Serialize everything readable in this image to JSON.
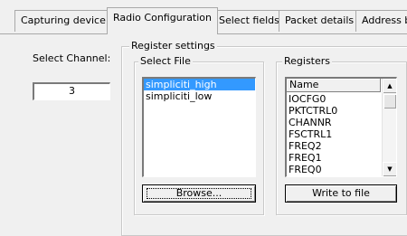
{
  "tabs": [
    {
      "label": "Capturing device"
    },
    {
      "label": "Radio Configuration",
      "active": true
    },
    {
      "label": "Select fields"
    },
    {
      "label": "Packet details"
    },
    {
      "label": "Address b"
    }
  ],
  "channel": {
    "label": "Select Channel:",
    "value": "3"
  },
  "register_settings": {
    "title": "Register settings"
  },
  "select_file": {
    "title": "Select File",
    "items": [
      {
        "label": "simpliciti_high",
        "selected": true
      },
      {
        "label": "simpliciti_low"
      }
    ],
    "browse_label": "Browse..."
  },
  "registers": {
    "title": "Registers",
    "column_header": "Name",
    "rows": [
      "IOCFG0",
      "PKTCTRL0",
      "CHANNR",
      "FSCTRL1",
      "FREQ2",
      "FREQ1",
      "FREQ0"
    ],
    "write_label": "Write to file"
  },
  "colors": {
    "selection": "#3399ff",
    "background": "#f0f0f0"
  }
}
